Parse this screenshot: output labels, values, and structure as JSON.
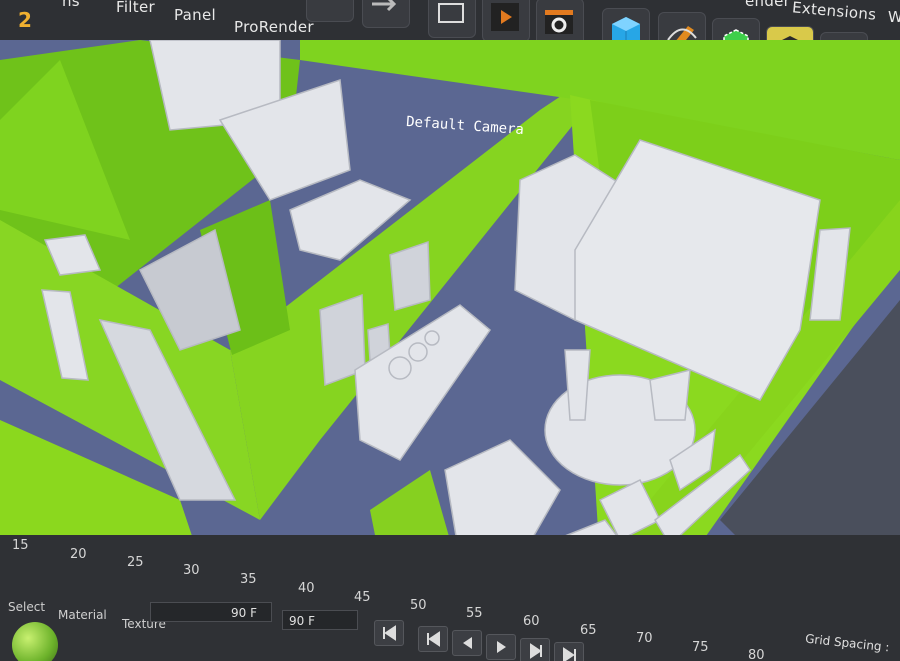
{
  "menu": {
    "items": [
      "Filter",
      "Panel",
      "ProRender",
      "Extensions"
    ],
    "partial_left": "ns",
    "partial_right_top": "ender",
    "partial_right": "W"
  },
  "toolbar": {
    "icons": [
      "record-icon",
      "play-icon",
      "settings-clapper-icon",
      "cube-icon",
      "pen-icon",
      "move-object-icon",
      "polygon-mode-icon",
      "edge-mode-icon",
      "point-mode-icon"
    ],
    "highlighted": "polygon-mode-icon"
  },
  "viewport": {
    "camera_label": "Default Camera",
    "colors": {
      "walls": "#7fcf1a",
      "floor": "#5f6a93",
      "furniture": "#e6e8ec"
    }
  },
  "timeline": {
    "ruler": [
      "15",
      "20",
      "25",
      "30",
      "35",
      "40",
      "45",
      "50",
      "55",
      "60",
      "65",
      "70",
      "75",
      "80"
    ],
    "tabs": [
      "Select",
      "Material",
      "Texture"
    ],
    "end_frame": "90 F",
    "current_frame": "90 F",
    "grid_spacing_label": "Grid Spacing :"
  },
  "top_left_glyph": "2",
  "highlight_color": "#e0d040"
}
